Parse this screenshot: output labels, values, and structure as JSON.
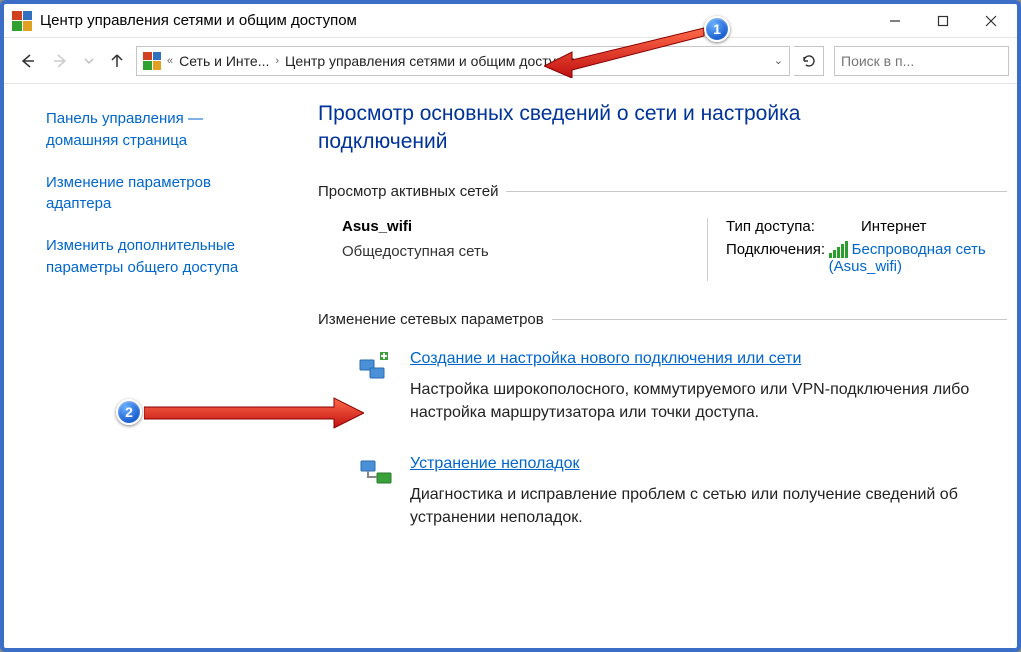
{
  "window": {
    "title": "Центр управления сетями и общим доступом"
  },
  "address": {
    "crumb1": "Сеть и Инте...",
    "crumb2": "Центр управления сетями и общим доступом"
  },
  "search": {
    "placeholder": "Поиск в п..."
  },
  "sidebar": {
    "home": "Панель управления — домашняя страница",
    "adapter": "Изменение параметров адаптера",
    "sharing": "Изменить дополнительные параметры общего доступа"
  },
  "content": {
    "heading": "Просмотр основных сведений о сети и настройка подключений",
    "active_header": "Просмотр активных сетей",
    "network": {
      "name": "Asus_wifi",
      "category": "Общедоступная сеть",
      "access_label": "Тип доступа:",
      "access_value": "Интернет",
      "conn_label": "Подключения:",
      "conn_link": "Беспроводная сеть (Asus_wifi)"
    },
    "change_header": "Изменение сетевых параметров",
    "items": [
      {
        "title": "Создание и настройка нового подключения или сети",
        "desc": "Настройка широкополосного, коммутируемого или VPN-подключения либо настройка маршрутизатора или точки доступа."
      },
      {
        "title": "Устранение неполадок",
        "desc": "Диагностика и исправление проблем с сетью или получение сведений об устранении неполадок."
      }
    ]
  },
  "annotations": {
    "b1": "1",
    "b2": "2"
  }
}
